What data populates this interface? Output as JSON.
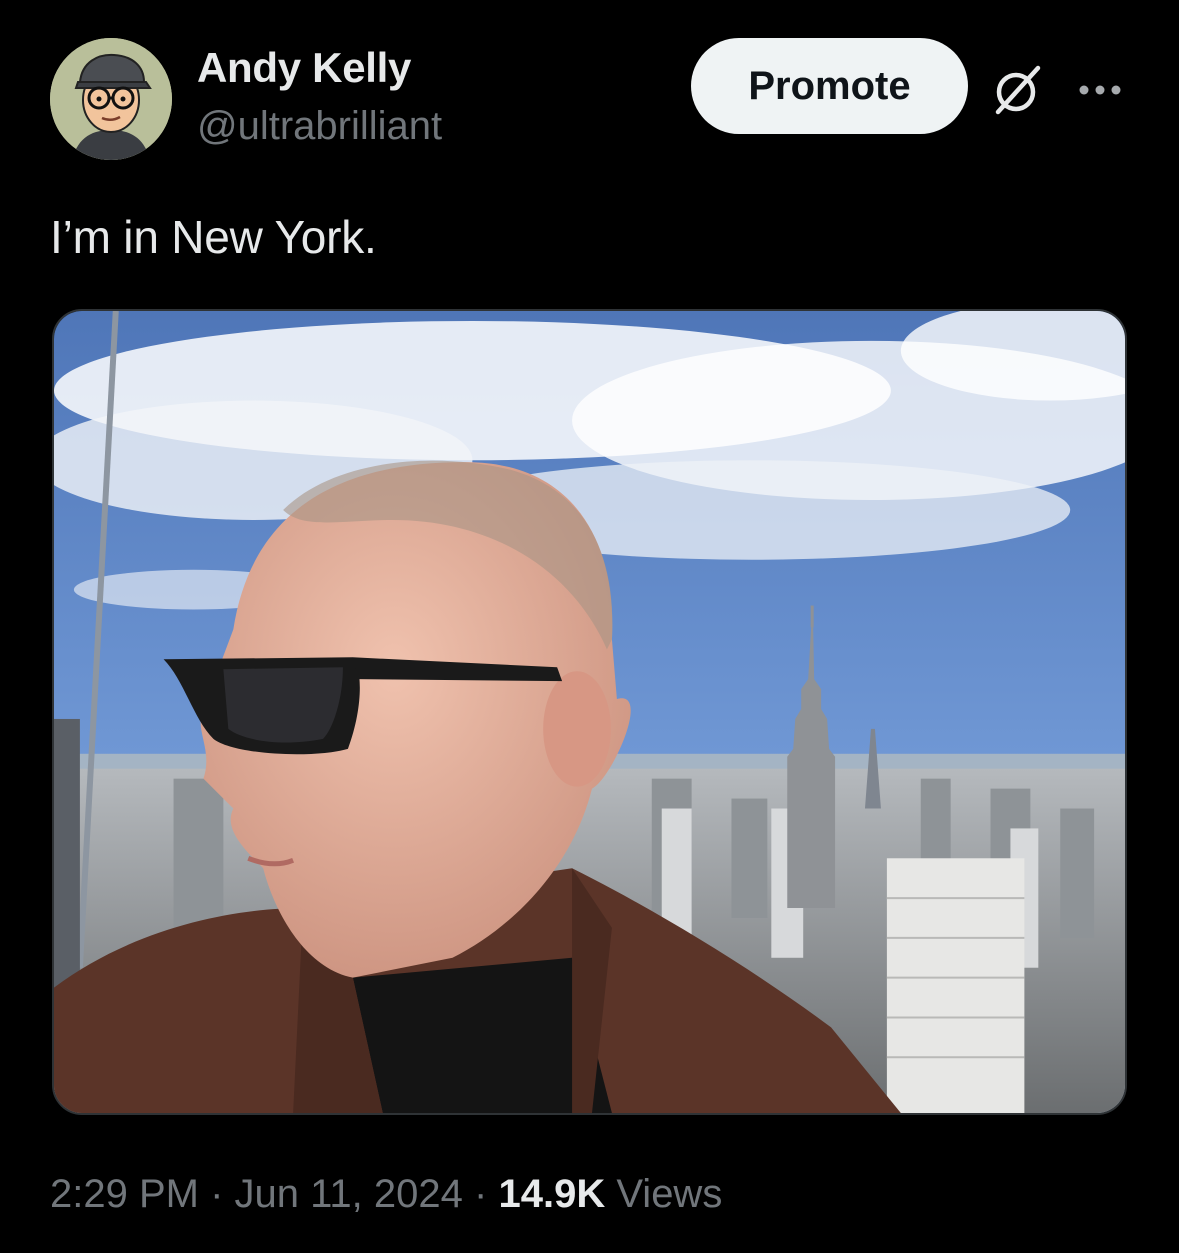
{
  "author": {
    "display_name": "Andy Kelly",
    "handle": "@ultrabrilliant",
    "avatar_icon": "cartoon-avatar-icon"
  },
  "actions": {
    "promote_label": "Promote",
    "grok_icon": "grok-icon",
    "more_icon": "more-icon"
  },
  "tweet": {
    "text": "I’m in New York.",
    "media_icon": "photo-nyc-skyline"
  },
  "meta": {
    "time": "2:29 PM",
    "separator": "·",
    "date": "Jun 11, 2024",
    "views_count": "14.9K",
    "views_label": "Views"
  },
  "colors": {
    "background": "#000000",
    "primary_text": "#e7e9ea",
    "secondary_text": "#71767b",
    "promote_bg": "#eff3f4"
  }
}
